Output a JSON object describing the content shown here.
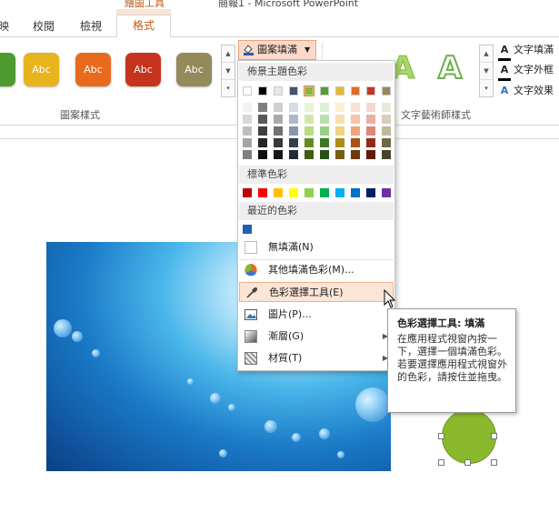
{
  "window": {
    "title": "簡報1 - Microsoft PowerPoint",
    "context_tab_group": "繪圖工具"
  },
  "tabs": [
    {
      "label": "映"
    },
    {
      "label": "校閱"
    },
    {
      "label": "檢視"
    },
    {
      "label": "格式",
      "active": true
    }
  ],
  "ribbon": {
    "shape_styles": [
      {
        "label": "",
        "color": "#4e9a2e"
      },
      {
        "label": "Abc",
        "color": "#e8b41e"
      },
      {
        "label": "Abc",
        "color": "#e86b1d"
      },
      {
        "label": "Abc",
        "color": "#c7341e"
      },
      {
        "label": "Abc",
        "color": "#938a5a"
      }
    ],
    "shape_styles_group_label": "圖案樣式",
    "fill_button_label": "圖案填滿",
    "wordart_group_label": "文字藝術師樣式",
    "text_options": [
      {
        "glyph": "A",
        "label": "文字填滿"
      },
      {
        "glyph": "A",
        "label": "文字外框"
      },
      {
        "glyph": "A",
        "label": "文字效果"
      }
    ]
  },
  "dropdown": {
    "theme_colors_header": "佈景主題色彩",
    "theme_colors": [
      "#ffffff",
      "#000000",
      "#e7e6e6",
      "#44546a",
      "#8ab92e",
      "#52a12f",
      "#e6b92b",
      "#e06d23",
      "#c6371f",
      "#938a5a"
    ],
    "theme_shades": [
      [
        "#f2f2f2",
        "#d8d8d8",
        "#bfbfbf",
        "#a5a5a5",
        "#7f7f7f"
      ],
      [
        "#7f7f7f",
        "#595959",
        "#3f3f3f",
        "#262626",
        "#0d0d0d"
      ],
      [
        "#d0cece",
        "#aeaaaa",
        "#757070",
        "#3a3838",
        "#171616"
      ],
      [
        "#d6dce4",
        "#adb9ca",
        "#8496b0",
        "#323f4f",
        "#222a35"
      ],
      [
        "#e8f3d6",
        "#d1e7ae",
        "#b9db86",
        "#678b22",
        "#455c16"
      ],
      [
        "#dcefd6",
        "#b9dfad",
        "#95cf84",
        "#3d7823",
        "#295017"
      ],
      [
        "#faf0d4",
        "#f5e2aa",
        "#f0d47f",
        "#b18b1a",
        "#765d11"
      ],
      [
        "#f9e1d3",
        "#f3c3a7",
        "#ecA47b",
        "#a95117",
        "#70360f"
      ],
      [
        "#f4d7d2",
        "#e9afa5",
        "#dd8779",
        "#942917",
        "#621c0f"
      ],
      [
        "#e9e7de",
        "#d4d0bd",
        "#bebb9c",
        "#6e6743",
        "#49452d"
      ]
    ],
    "standard_colors_header": "標準色彩",
    "standard_colors": [
      "#c00000",
      "#ff0000",
      "#ffc000",
      "#ffff00",
      "#92d050",
      "#00b050",
      "#00b0f0",
      "#0070c0",
      "#002060",
      "#7030a0"
    ],
    "recent_colors_header": "最近的色彩",
    "recent_colors": [
      "#1f5fb4"
    ],
    "items": [
      {
        "label": "無填滿(N)",
        "icon": "no-fill-icon"
      },
      {
        "label": "其他填滿色彩(M)...",
        "icon": "color-wheel-icon"
      },
      {
        "label": "色彩選擇工具(E)",
        "icon": "eyedropper-icon",
        "highlighted": true
      },
      {
        "label": "圖片(P)...",
        "icon": "picture-icon"
      },
      {
        "label": "漸層(G)",
        "icon": "gradient-icon",
        "submenu": true
      },
      {
        "label": "材質(T)",
        "icon": "texture-icon",
        "submenu": true
      }
    ]
  },
  "tooltip": {
    "title": "色彩選擇工具: 填滿",
    "body": "在應用程式視窗內按一下，選擇一個填滿色彩。若要選擇應用程式視窗外的色彩，請按住並拖曳。"
  },
  "slide": {
    "circle_color": "#8ab92e"
  }
}
